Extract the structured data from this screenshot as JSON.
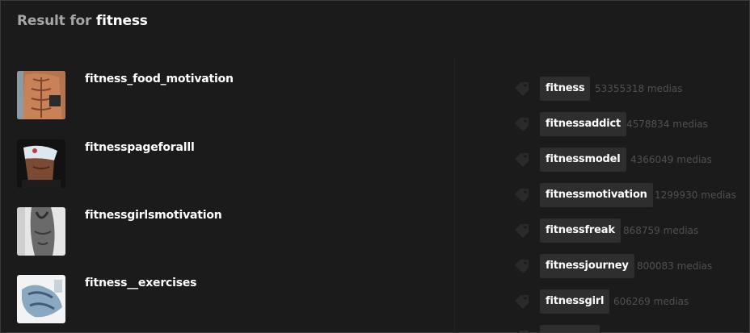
{
  "header": {
    "prefix": "Result for",
    "query": "fitness"
  },
  "users": [
    {
      "username": "fitness_food_motivation",
      "avatar_icon": "avatar-photo-icon"
    },
    {
      "username": "fitnesspageforalll",
      "avatar_icon": "avatar-photo-icon"
    },
    {
      "username": "fitnessgirlsmotivation",
      "avatar_icon": "avatar-photo-icon"
    },
    {
      "username": "fitness__exercises",
      "avatar_icon": "avatar-photo-icon"
    }
  ],
  "tags": [
    {
      "name": "fitness",
      "count": "53355318 medias"
    },
    {
      "name": "fitnessaddict",
      "count": "4578834 medias"
    },
    {
      "name": "fitnessmodel",
      "count": "4366049 medias"
    },
    {
      "name": "fitnessmotivation",
      "count": "1299930 medias"
    },
    {
      "name": "fitnessfreak",
      "count": "868759 medias"
    },
    {
      "name": "fitnessjourney",
      "count": "800083 medias"
    },
    {
      "name": "fitnessgirl",
      "count": "606269 medias"
    }
  ],
  "colors": {
    "background": "#1b1b1b",
    "pill": "#2e2e2e",
    "muted_text": "#505050",
    "title_prefix": "#a6a6a6"
  }
}
